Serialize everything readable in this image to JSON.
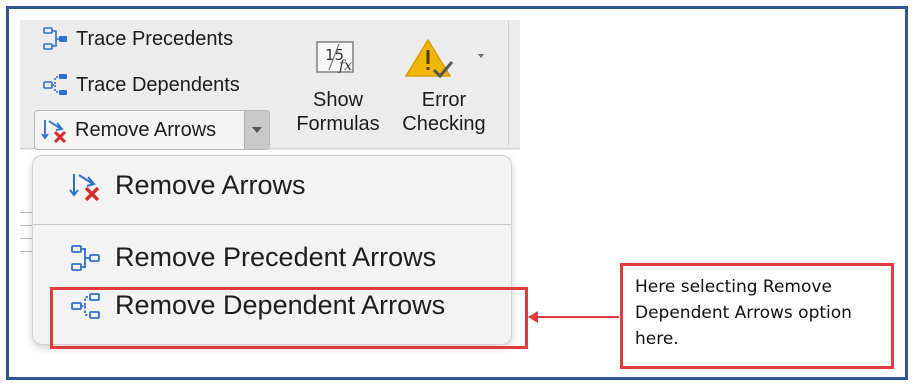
{
  "ribbon": {
    "trace_precedents": "Trace Precedents",
    "trace_dependents": "Trace Dependents",
    "remove_arrows": "Remove Arrows",
    "show_formulas_line1": "Show",
    "show_formulas_line2": "Formulas",
    "error_checking_line1": "Error",
    "error_checking_line2": "Checking",
    "formula_icon_text": "15",
    "formula_icon_fx": "fx"
  },
  "menu": {
    "items": [
      {
        "label": "Remove Arrows",
        "icon": "remove-arrows-icon"
      },
      {
        "label": "Remove Precedent Arrows",
        "icon": "remove-precedent-arrows-icon"
      },
      {
        "label": "Remove Dependent Arrows",
        "icon": "remove-dependent-arrows-icon"
      }
    ],
    "selected_index": 2
  },
  "annotation": {
    "callout_text": "Here selecting Remove Dependent Arrows option here."
  },
  "colors": {
    "accent_blue": "#2f6fd1",
    "highlight_red": "#e23b3b",
    "frame_blue": "#2f5597",
    "warning_yellow": "#f2b705"
  }
}
